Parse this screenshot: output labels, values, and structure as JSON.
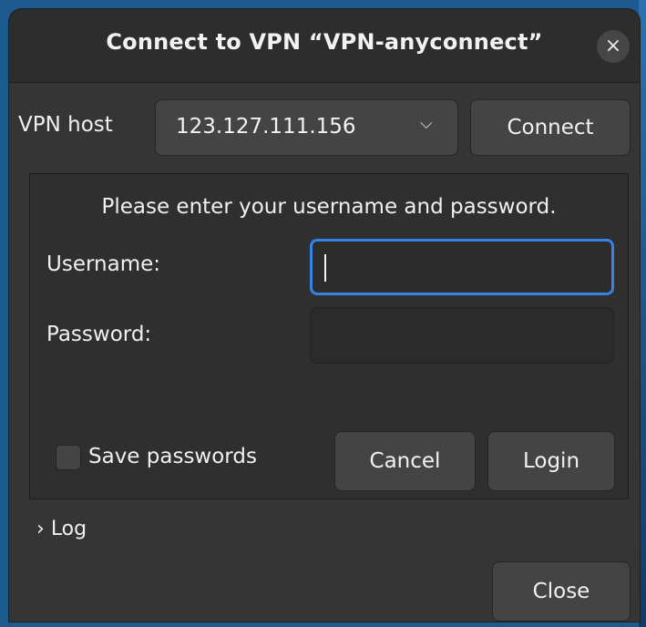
{
  "dialog": {
    "title": "Connect to VPN “VPN-anyconnect”",
    "close_glyph": "×"
  },
  "host_row": {
    "label": "VPN host",
    "value": "123.127.111.156",
    "dropdown_glyph": "⌵",
    "connect_label": "Connect"
  },
  "auth": {
    "prompt": "Please enter your username and password.",
    "username_label": "Username:",
    "username_value": "",
    "password_label": "Password:",
    "password_value": "",
    "save_passwords_label": "Save passwords",
    "save_passwords_checked": false,
    "cancel_label": "Cancel",
    "login_label": "Login"
  },
  "log": {
    "chevron": "›",
    "label": "Log"
  },
  "footer": {
    "close_label": "Close"
  },
  "colors": {
    "accent": "#3584e4",
    "window_bg": "#353535",
    "titlebar_bg": "#2d2d2d"
  },
  "icons": {
    "close": "close-icon",
    "dropdown": "chevron-down-icon",
    "expander": "chevron-right-icon"
  }
}
